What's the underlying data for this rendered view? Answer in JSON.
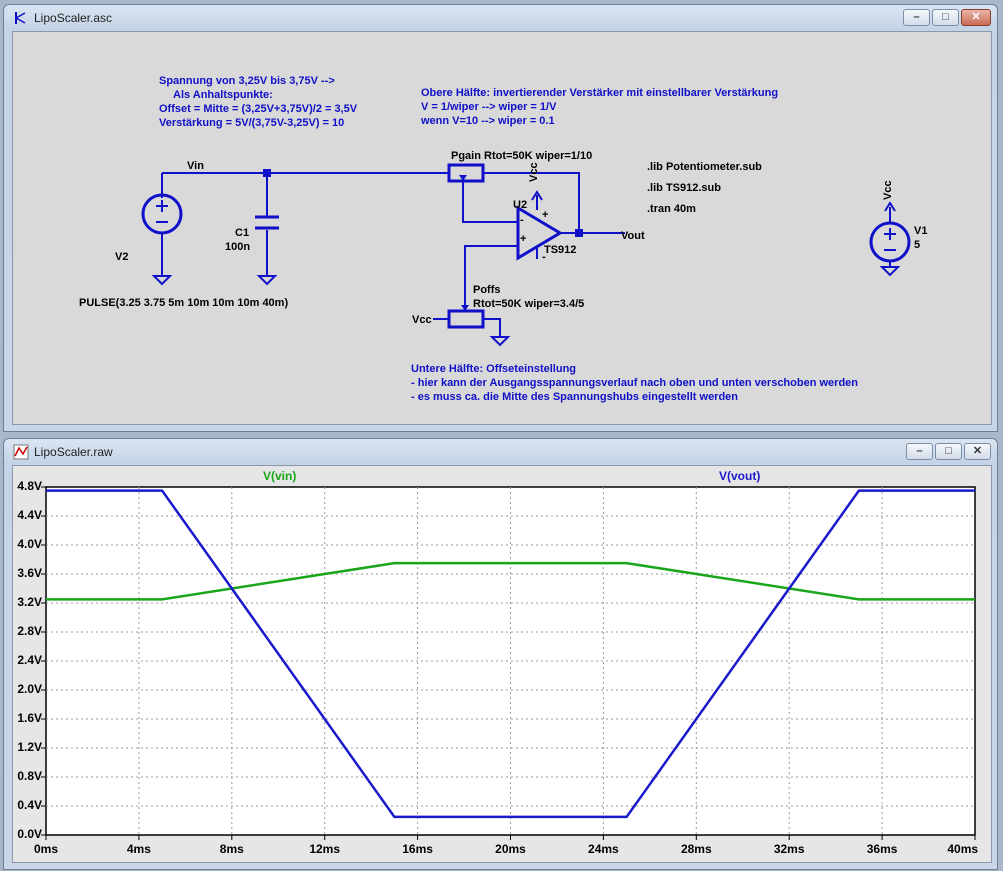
{
  "schematic_window": {
    "title": "LipoScaler.asc",
    "icon": "schematic-icon",
    "buttons": {
      "minimize": "–",
      "restore": "□",
      "close": "✕"
    },
    "notes": [
      "Spannung von 3,25V bis 3,75V -->",
      "Als Anhaltspunkte:",
      "Offset = Mitte = (3,25V+3,75V)/2 = 3,5V",
      "Verstärkung = 5V/(3,75V-3,25V) = 10"
    ],
    "upper_notes": [
      "Obere Hälfte: invertierender Verstärker mit einstellbarer Verstärkung",
      "V = 1/wiper --> wiper = 1/V",
      "wenn V=10 --> wiper = 0.1"
    ],
    "directives": [
      ".lib Potentiometer.sub",
      ".lib TS912.sub",
      ".tran 40m"
    ],
    "lower_notes": [
      "Untere Hälfte: Offseteinstellung",
      "- hier kann der Ausgangsspannungsverlauf nach oben und unten verschoben werden",
      "- es muss ca. die Mitte des Spannungshubs eingestellt werden"
    ],
    "labels": {
      "vin": "Vin",
      "vout": "Vout",
      "c1": "C1",
      "c1_value": "100n",
      "v2": "V2",
      "v2_value": "PULSE(3.25 3.75 5m 10m 10m 10m 40m)",
      "pgain": "Pgain Rtot=50K wiper=1/10",
      "u2": "U2",
      "u2_model": "TS912",
      "vcc_top": "Vcc",
      "poffs": "Poffs",
      "poffs_value": "Rtot=50K wiper=3.4/5",
      "vcc_left": "Vcc",
      "v1": "V1",
      "v1_value": "5",
      "vcc_v1": "Vcc",
      "plus": "+",
      "minus": "-",
      "plus2": "+",
      "minus2": "-"
    }
  },
  "waveform_window": {
    "title": "LipoScaler.raw",
    "icon": "waveform-icon",
    "buttons": {
      "minimize": "–",
      "restore": "□",
      "close": "✕"
    }
  },
  "chart_data": {
    "type": "line",
    "x_unit": "ms",
    "xlim": [
      0,
      40
    ],
    "ylim": [
      0,
      4.8
    ],
    "x_ticks": [
      "0ms",
      "4ms",
      "8ms",
      "12ms",
      "16ms",
      "20ms",
      "24ms",
      "28ms",
      "32ms",
      "36ms",
      "40ms"
    ],
    "y_ticks": [
      "0.0V",
      "0.4V",
      "0.8V",
      "1.2V",
      "1.6V",
      "2.0V",
      "2.4V",
      "2.8V",
      "3.2V",
      "3.6V",
      "4.0V",
      "4.4V",
      "4.8V"
    ],
    "grid": true,
    "series": [
      {
        "name": "V(vin)",
        "color": "#1aa51a",
        "x": [
          0,
          5,
          15,
          25,
          35,
          40
        ],
        "y": [
          3.25,
          3.25,
          3.75,
          3.75,
          3.25,
          3.25
        ]
      },
      {
        "name": "V(vout)",
        "color": "#1a1acc",
        "x": [
          0,
          5,
          15,
          25,
          35,
          40
        ],
        "y": [
          4.75,
          4.75,
          0.25,
          0.25,
          4.75,
          4.75
        ]
      }
    ]
  },
  "colors": {
    "wire": "#1010c8",
    "component": "#1010c8"
  }
}
